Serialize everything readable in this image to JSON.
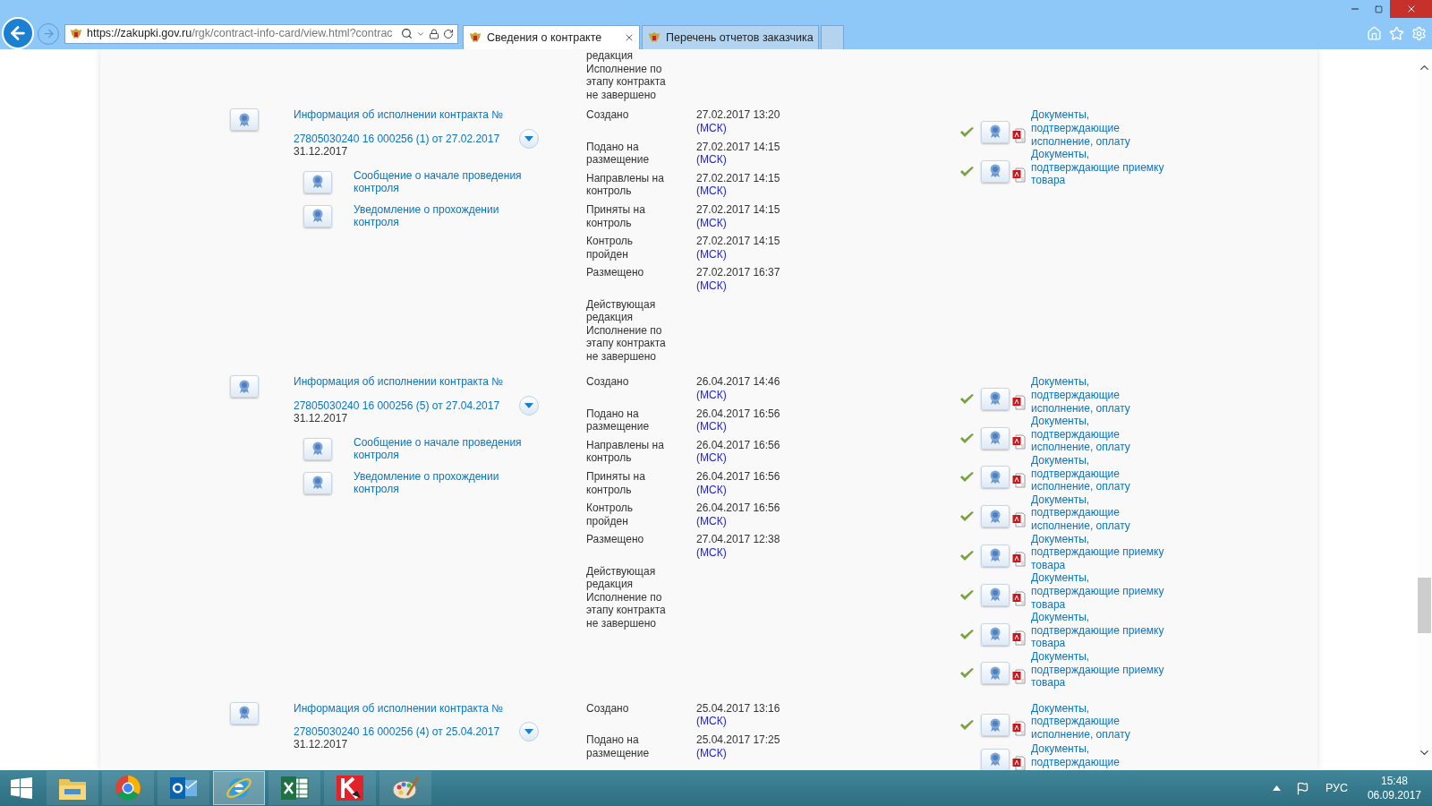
{
  "browser": {
    "address_host": "https://zakupki.gov.ru",
    "address_path": "/rgk/contract-info-card/view.html?contrac",
    "tabs": [
      {
        "label": "Сведения о контракте",
        "selected": true,
        "closable": true
      },
      {
        "label": "Перечень отчетов заказчика",
        "selected": false,
        "closable": false
      }
    ]
  },
  "top_partial": {
    "status": [
      "редакция",
      "Исполнение по этапу контракта не завершено"
    ]
  },
  "blocks": [
    {
      "title": "Информация об исполнении контракта №",
      "number": "27805030240 16 000256 (1) от 27.02.2017",
      "end_date": "31.12.2017",
      "sub_items": [
        "Сообщение о начале проведения контроля",
        "Уведомление о прохождении контроля"
      ],
      "events": [
        {
          "label": "Создано",
          "date": "27.02.2017 13:20",
          "tz": "(МСК)"
        },
        {
          "label": "Подано на размещение",
          "date": "27.02.2017 14:15",
          "tz": "(МСК)"
        },
        {
          "label": "Направлены на контроль",
          "date": "27.02.2017 14:15",
          "tz": "(МСК)"
        },
        {
          "label": "Приняты на контроль",
          "date": "27.02.2017 14:15",
          "tz": "(МСК)"
        },
        {
          "label": "Контроль пройден",
          "date": "27.02.2017 14:15",
          "tz": "(МСК)"
        },
        {
          "label": "Размещено",
          "date": "27.02.2017 16:37",
          "tz": "(МСК)"
        }
      ],
      "status": [
        "Действующая редакция",
        "Исполнение по этапу контракта не завершено"
      ],
      "docs": [
        {
          "label": "Документы, подтверждающие исполнение, оплату",
          "verified": true
        },
        {
          "label": "Документы, подтверждающие приемку товара",
          "verified": true
        }
      ]
    },
    {
      "title": "Информация об исполнении контракта №",
      "number": "27805030240 16 000256 (5) от 27.04.2017",
      "end_date": "31.12.2017",
      "sub_items": [
        "Сообщение о начале проведения контроля",
        "Уведомление о прохождении контроля"
      ],
      "events": [
        {
          "label": "Создано",
          "date": "26.04.2017 14:46",
          "tz": "(МСК)"
        },
        {
          "label": "Подано на размещение",
          "date": "26.04.2017 16:56",
          "tz": "(МСК)"
        },
        {
          "label": "Направлены на контроль",
          "date": "26.04.2017 16:56",
          "tz": "(МСК)"
        },
        {
          "label": "Приняты на контроль",
          "date": "26.04.2017 16:56",
          "tz": "(МСК)"
        },
        {
          "label": "Контроль пройден",
          "date": "26.04.2017 16:56",
          "tz": "(МСК)"
        },
        {
          "label": "Размещено",
          "date": "27.04.2017 12:38",
          "tz": "(МСК)"
        }
      ],
      "status": [
        "Действующая редакция",
        "Исполнение по этапу контракта не завершено"
      ],
      "docs": [
        {
          "label": "Документы, подтверждающие исполнение, оплату",
          "verified": true
        },
        {
          "label": "Документы, подтверждающие исполнение, оплату",
          "verified": true
        },
        {
          "label": "Документы, подтверждающие исполнение, оплату",
          "verified": true
        },
        {
          "label": "Документы, подтверждающие исполнение, оплату",
          "verified": true
        },
        {
          "label": "Документы, подтверждающие приемку товара",
          "verified": true
        },
        {
          "label": "Документы, подтверждающие приемку товара",
          "verified": true
        },
        {
          "label": "Документы, подтверждающие приемку товара",
          "verified": true
        },
        {
          "label": "Документы, подтверждающие приемку товара",
          "verified": true
        }
      ]
    },
    {
      "title": "Информация об исполнении контракта №",
      "number": "27805030240 16 000256 (4) от 25.04.2017",
      "end_date": "31.12.2017",
      "events": [
        {
          "label": "Создано",
          "date": "25.04.2017 13:16",
          "tz": "(МСК)"
        },
        {
          "label": "Подано на размещение",
          "date": "25.04.2017 17:25",
          "tz": "(МСК)"
        }
      ],
      "docs": [
        {
          "label": "Документы, подтверждающие исполнение, оплату",
          "verified": true
        },
        {
          "label": "Документы, подтверждающие"
        }
      ]
    }
  ],
  "taskbar": {
    "apps": [
      {
        "kind": "folder",
        "selected": false
      },
      {
        "kind": "chrome",
        "selected": false
      },
      {
        "kind": "mail",
        "selected": false
      },
      {
        "kind": "ie",
        "selected": true
      },
      {
        "kind": "sheet",
        "selected": false
      },
      {
        "kind": "shield",
        "selected": false
      },
      {
        "kind": "paint",
        "selected": false
      }
    ],
    "language": "РУС",
    "time": "15:48",
    "date": "06.09.2017"
  }
}
